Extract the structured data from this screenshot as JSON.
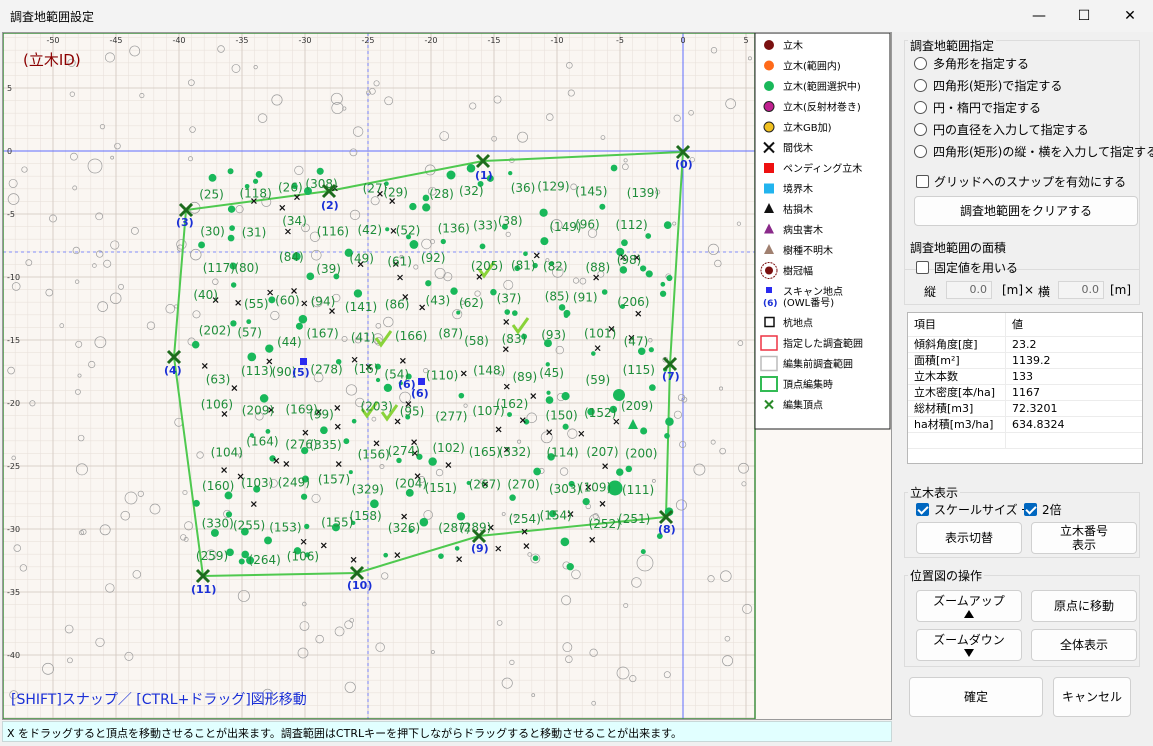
{
  "window": {
    "title": "調査地範囲設定",
    "minimize_glyph": "—",
    "maximize_glyph": "☐",
    "close_glyph": "✕"
  },
  "plot": {
    "id_label": "(立木ID)",
    "hint": "[SHIFT]スナップ／ [CTRL+ドラッグ]図形移動",
    "x_ticks": [
      "-50",
      "-45",
      "-40",
      "-35",
      "-30",
      "-25",
      "-20",
      "-15",
      "-10",
      "-5",
      "0",
      "5"
    ],
    "y_ticks": [
      "5",
      "0",
      "-5",
      "-10",
      "-15",
      "-20",
      "-25",
      "-30",
      "-35",
      "-40"
    ],
    "vertex_labels": [
      "(0)",
      "(1)",
      "(2)",
      "(3)",
      "(4)",
      "(5)",
      "(6)",
      "(7)",
      "(8)",
      "(9)",
      "(10)",
      "(11)"
    ],
    "tree_labels": [
      "(25)",
      "(118)",
      "(26)",
      "(308)",
      "(27)",
      "(29)",
      "(28)",
      "(32)",
      "(36)",
      "(129)",
      "(145)",
      "(139)",
      "(30)",
      "(31)",
      "(34)",
      "(116)",
      "(42)",
      "(52)",
      "(136)",
      "(33)",
      "(38)",
      "(149)",
      "(96)",
      "(112)",
      "(117)",
      "(80)",
      "(84)",
      "(39)",
      "(49)",
      "(61)",
      "(92)",
      "(205)",
      "(81)",
      "(82)",
      "(88)",
      "(98)",
      "(40)",
      "(55)",
      "(60)",
      "(94)",
      "(141)",
      "(86)",
      "(43)",
      "(62)",
      "(37)",
      "(85)",
      "(91)",
      "(206)",
      "(202)",
      "(57)",
      "(44)",
      "(167)",
      "(41)",
      "(166)",
      "(87)",
      "(58)",
      "(83)",
      "(93)",
      "(101)",
      "(47)",
      "(63)",
      "(113)",
      "(90)",
      "(278)",
      "(16)",
      "(54)",
      "(110)",
      "(148)",
      "(89)",
      "(45)",
      "(59)",
      "(115)",
      "(106)",
      "(209)",
      "(169)",
      "(99)",
      "(203)",
      "(95)",
      "(277)",
      "(107)",
      "(162)",
      "(150)",
      "(152)",
      "(209)",
      "(104)",
      "(164)",
      "(276)",
      "(335)",
      "(156)",
      "(274)",
      "(102)",
      "(165)",
      "(332)",
      "(114)",
      "(207)",
      "(200)",
      "(160)",
      "(103)",
      "(249)",
      "(157)",
      "(329)",
      "(204)",
      "(151)",
      "(267)",
      "(270)",
      "(303)",
      "(109)",
      "(111)",
      "(330)",
      "(255)",
      "(153)",
      "(155)",
      "(158)",
      "(326)",
      "(287)",
      "(289)",
      "(254)",
      "(154)",
      "(252)",
      "(251)",
      "(259)",
      "(264)",
      "(106)"
    ],
    "legend": [
      {
        "label": "立木",
        "icon": "dot-maroon"
      },
      {
        "label": "立木(範囲内)",
        "icon": "dot-orange"
      },
      {
        "label": "立木(範囲選択中)",
        "icon": "dot-green"
      },
      {
        "label": "立木(反射材巻き)",
        "icon": "dot-magenta"
      },
      {
        "label": "立木GB加)",
        "icon": "dot-yellow"
      },
      {
        "label": "間伐木",
        "icon": "cross-black"
      },
      {
        "label": "ペンディング立木",
        "icon": "square-red"
      },
      {
        "label": "境界木",
        "icon": "square-cyan"
      },
      {
        "label": "枯損木",
        "icon": "triangle-black"
      },
      {
        "label": "病虫害木",
        "icon": "triangle-purple"
      },
      {
        "label": "樹種不明木",
        "icon": "triangle-tan"
      },
      {
        "label": "樹冠幅",
        "icon": "crown-circle"
      },
      {
        "label": "スキャン地点",
        "sub": "(OWL番号)",
        "icon": "scan-square"
      },
      {
        "label": "杭地点",
        "icon": "stake-square"
      },
      {
        "label": "指定した調査範囲",
        "icon": "box-red"
      },
      {
        "label": "編集前調査範囲",
        "icon": "box-gray"
      },
      {
        "label": "頂点編集時",
        "icon": "box-green"
      },
      {
        "label": "編集頂点",
        "icon": "x-green"
      }
    ],
    "scan_label": "(6)",
    "colors": {
      "boundary": "#4fc94f",
      "tree": "#19b85a",
      "axis": "#5d6cff",
      "label": "#1f8d3a",
      "vertex_label": "#1a2fd6"
    }
  },
  "status": "X をドラッグすると頂点を移動させることが出来ます。調査範囲はCTRLキーを押下しながらドラッグすると移動させることが出来ます。",
  "range_spec": {
    "title": "調査地範囲指定",
    "options": [
      "多角形を指定する",
      "四角形(矩形)で指定する",
      "円・楕円で指定する",
      "円の直径を入力して指定する",
      "四角形(矩形)の縦・横を入力して指定する"
    ],
    "snap_label": "グリッドへのスナップを有効にする",
    "clear_button": "調査地範囲をクリアする"
  },
  "area": {
    "title": "調査地範囲の面積",
    "fixed_label": "固定値を用いる",
    "tate": "縦",
    "yoko": "横",
    "unit": "[m]",
    "times": "×",
    "tate_value": "0.0",
    "yoko_value": "0.0"
  },
  "table": {
    "headers": [
      "項目",
      "値"
    ],
    "rows": [
      [
        "傾斜角度[度]",
        "23.2"
      ],
      [
        "面積[m²]",
        "1139.2"
      ],
      [
        "立木本数",
        "133"
      ],
      [
        "立木密度[本/ha]",
        "1167"
      ],
      [
        "総材積[m3]",
        "72.3201"
      ],
      [
        "ha材積[m3/ha]",
        "634.8324"
      ]
    ]
  },
  "display": {
    "title": "立木表示",
    "scale_label": "スケールサイズ 一",
    "double_label": "2倍",
    "toggle_button": "表示切替",
    "number_button_l1": "立木番号",
    "number_button_l2": "表示"
  },
  "nav": {
    "title": "位置図の操作",
    "zoom_in": "ズームアップ",
    "origin": "原点に移動",
    "zoom_out": "ズームダウン",
    "fit": "全体表示"
  },
  "footer": {
    "ok": "確定",
    "cancel": "キャンセル"
  }
}
